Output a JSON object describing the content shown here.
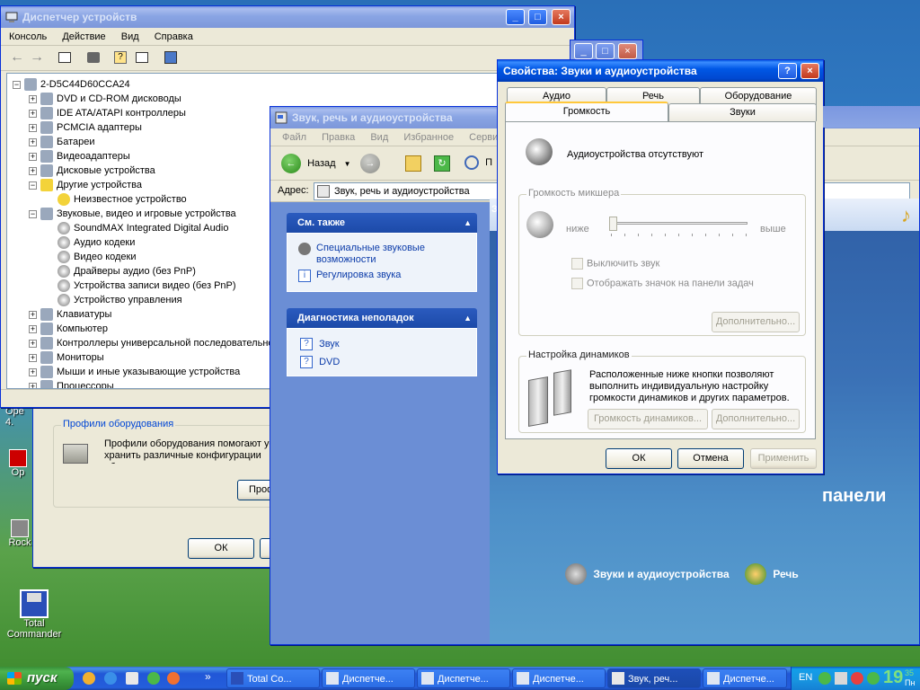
{
  "desktop": {
    "icons": [
      {
        "label": "Op",
        "id": "op"
      },
      {
        "label": "Rock",
        "id": "rock"
      },
      {
        "label": "Total Commander",
        "id": "tc"
      }
    ],
    "partial_text": "Ope\n4."
  },
  "devmgr": {
    "title": "Диспетчер устройств",
    "menu": [
      "Консоль",
      "Действие",
      "Вид",
      "Справка"
    ],
    "tree": [
      {
        "label": "2-D5C44D60CCA24",
        "level": 0,
        "exp": "−"
      },
      {
        "label": "DVD и CD-ROM дисководы",
        "level": 1,
        "exp": "+"
      },
      {
        "label": "IDE ATA/ATAPI контроллеры",
        "level": 1,
        "exp": "+"
      },
      {
        "label": "PCMCIA адаптеры",
        "level": 1,
        "exp": "+"
      },
      {
        "label": "Батареи",
        "level": 1,
        "exp": "+"
      },
      {
        "label": "Видеоадаптеры",
        "level": 1,
        "exp": "+"
      },
      {
        "label": "Дисковые устройства",
        "level": 1,
        "exp": "+"
      },
      {
        "label": "Другие устройства",
        "level": 1,
        "exp": "−"
      },
      {
        "label": "Неизвестное устройство",
        "level": 2,
        "exp": ""
      },
      {
        "label": "Звуковые, видео и игровые устройства",
        "level": 1,
        "exp": "−"
      },
      {
        "label": "SoundMAX Integrated Digital Audio",
        "level": 2,
        "exp": ""
      },
      {
        "label": "Аудио кодеки",
        "level": 2,
        "exp": ""
      },
      {
        "label": "Видео кодеки",
        "level": 2,
        "exp": ""
      },
      {
        "label": "Драйверы аудио (без PnP)",
        "level": 2,
        "exp": ""
      },
      {
        "label": "Устройства записи видео (без PnP)",
        "level": 2,
        "exp": ""
      },
      {
        "label": "Устройство управления",
        "level": 2,
        "exp": ""
      },
      {
        "label": "Клавиатуры",
        "level": 1,
        "exp": "+"
      },
      {
        "label": "Компьютер",
        "level": 1,
        "exp": "+"
      },
      {
        "label": "Контроллеры универсальной последовательной",
        "level": 1,
        "exp": "+"
      },
      {
        "label": "Мониторы",
        "level": 1,
        "exp": "+"
      },
      {
        "label": "Мыши и иные указывающие устройства",
        "level": 1,
        "exp": "+"
      },
      {
        "label": "Процессоры",
        "level": 1,
        "exp": "+"
      }
    ]
  },
  "sysprops": {
    "group_title": "Профили оборудования",
    "text": "Профили оборудования помогают ус хранить различные конфигурации об",
    "button_partial": "Проф",
    "ok": "ОК"
  },
  "explorer": {
    "title": "Звук, речь и аудиоустройства",
    "menu": [
      "Файл",
      "Правка",
      "Вид",
      "Избранное",
      "Сервис"
    ],
    "back": "Назад",
    "search_partial": "П",
    "address_label": "Адрес:",
    "address_value": "Звук, речь и аудиоустройства",
    "see_also": {
      "title": "См. также",
      "items": [
        "Специальные звуковые возможности",
        "Регулировка звука"
      ]
    },
    "troubleshoot": {
      "title": "Диагностика неполадок",
      "items": [
        "Звук",
        "DVD"
      ]
    },
    "content_partial": "З",
    "big_text_partial": "панели",
    "cp_items": [
      "Звуки и аудиоустройства",
      "Речь"
    ]
  },
  "soundprops": {
    "title": "Свойства: Звуки и аудиоустройства",
    "tabs_row1": [
      "Аудио",
      "Речь",
      "Оборудование"
    ],
    "tabs_row2": [
      "Громкость",
      "Звуки"
    ],
    "no_devices": "Аудиоустройства отсутствуют",
    "mixer_group": "Громкость микшера",
    "low": "ниже",
    "high": "выше",
    "volume_level": 0,
    "mute": "Выключить звук",
    "show_icon": "Отображать значок на панели задач",
    "advanced": "Дополнительно...",
    "speaker_group": "Настройка динамиков",
    "speaker_text": "Расположенные ниже кнопки позволяют выполнить индивидуальную настройку громкости динамиков и других параметров.",
    "speaker_volume": "Громкость динамиков...",
    "advanced2": "Дополнительно...",
    "ok": "ОК",
    "cancel": "Отмена",
    "apply": "Применить"
  },
  "taskbar": {
    "start": "пуск",
    "tasks": [
      "Total Co...",
      "Диспетче...",
      "Диспетче...",
      "Диспетче...",
      "Звук, реч...",
      "Диспетче..."
    ],
    "lang": "EN",
    "time": "19",
    "time_small": "35",
    "day": "Пн"
  },
  "colors": {
    "titlebar": "#0058e6",
    "dialog_bg": "#ece9d8",
    "taskpane": "#6c8fd6",
    "link": "#0b3ba9"
  }
}
